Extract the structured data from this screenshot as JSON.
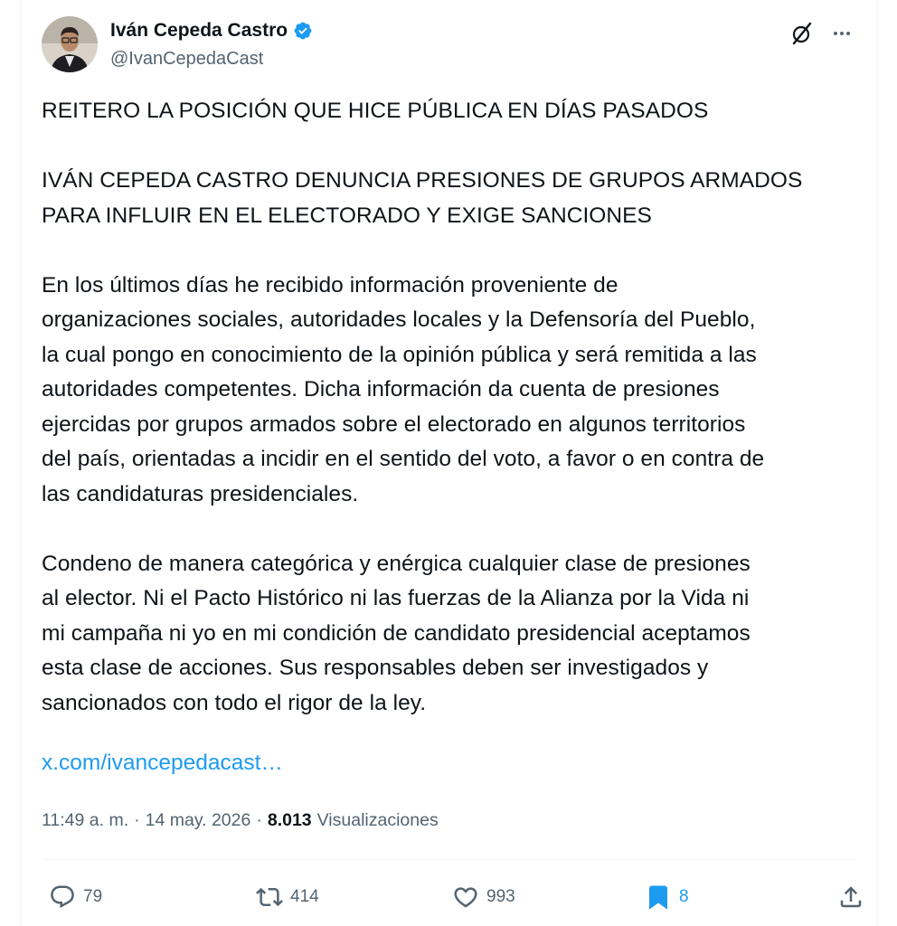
{
  "author": {
    "name": "Iván Cepeda Castro",
    "handle": "@IvanCepedaCast"
  },
  "tweet": {
    "paragraphs": [
      "REITERO LA POSICIÓN QUE HICE PÚBLICA EN DÍAS PASADOS",
      "IVÁN CEPEDA CASTRO DENUNCIA PRESIONES DE GRUPOS ARMADOS\nPARA INFLUIR EN EL ELECTORADO Y EXIGE SANCIONES",
      "En los últimos días he recibido información proveniente de\norganizaciones sociales, autoridades locales y la Defensoría del Pueblo,\nla cual pongo en conocimiento de la opinión pública y será remitida a las\nautoridades competentes. Dicha información da cuenta de presiones\nejercidas por grupos armados sobre el electorado en algunos territorios\ndel país, orientadas a incidir en el sentido del voto, a favor o en contra de\nlas  candidaturas presidenciales.",
      "Condeno de manera categórica y enérgica cualquier clase de presiones\nal elector. Ni el Pacto Histórico ni las fuerzas de la Alianza por la Vida ni\nmi campaña ni yo en mi condición de candidato presidencial aceptamos\nesta clase de acciones. Sus responsables deben ser investigados y\nsancionados con todo el rigor de la ley."
    ],
    "link": "x.com/ivancepedacast…"
  },
  "meta": {
    "time": "11:49 a. m.",
    "separator": "·",
    "date": "14 may. 2026",
    "views_count": "8.013",
    "views_label": "Visualizaciones"
  },
  "actions": {
    "replies": "79",
    "retweets": "414",
    "likes": "993",
    "bookmarks": "8"
  },
  "colors": {
    "accent": "#1d9bf0",
    "text": "#0f1419",
    "secondary": "#536471"
  }
}
